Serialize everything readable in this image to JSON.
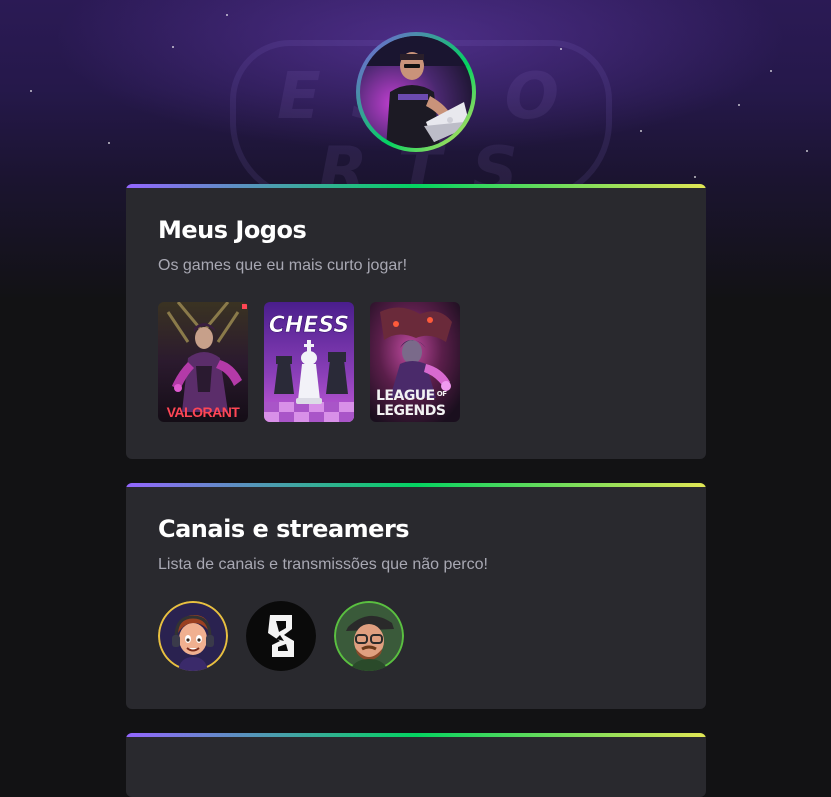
{
  "profile": {
    "avatar_icon": "gamer-avatar-photo"
  },
  "sections": [
    {
      "title": "Meus Jogos",
      "subtitle": "Os games que eu mais curto jogar!",
      "games": [
        {
          "name": "VALORANT",
          "icon": "valorant-cover"
        },
        {
          "name": "CHESS",
          "icon": "chess-cover"
        },
        {
          "name": "LEAGUE",
          "name2": "LEGENDS",
          "of": "OF",
          "icon": "league-of-legends-cover"
        }
      ]
    },
    {
      "title": "Canais e streamers",
      "subtitle": "Lista de canais e transmissões que não perco!",
      "streamers": [
        {
          "icon": "streamer-cartoon-headset-avatar"
        },
        {
          "icon": "streamer-logo-avatar"
        },
        {
          "icon": "streamer-cartoon-cap-avatar"
        }
      ]
    }
  ],
  "colors": {
    "page_bg": "#121214",
    "card_bg": "#29292e",
    "gradient": [
      "#9466ff",
      "#04d361",
      "#e1e655"
    ],
    "title": "#ffffff",
    "subtitle": "#a8a8b3"
  }
}
